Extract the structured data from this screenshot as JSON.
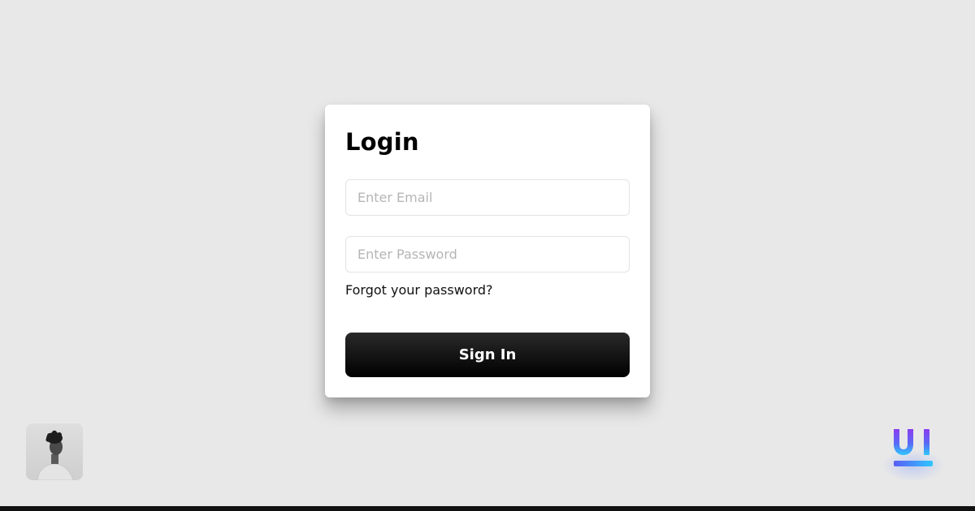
{
  "login": {
    "title": "Login",
    "email_placeholder": "Enter Email",
    "password_placeholder": "Enter Password",
    "forgot_label": "Forgot your password?",
    "signin_label": "Sign In"
  },
  "footer": {
    "avatar_icon": "user-avatar",
    "brand_icon": "ui-logo-icon"
  },
  "colors": {
    "background": "#e8e8e8",
    "card": "#ffffff",
    "button": "#000000",
    "brand_gradient_start": "#7b3ff2",
    "brand_gradient_end": "#2ec7ff"
  }
}
